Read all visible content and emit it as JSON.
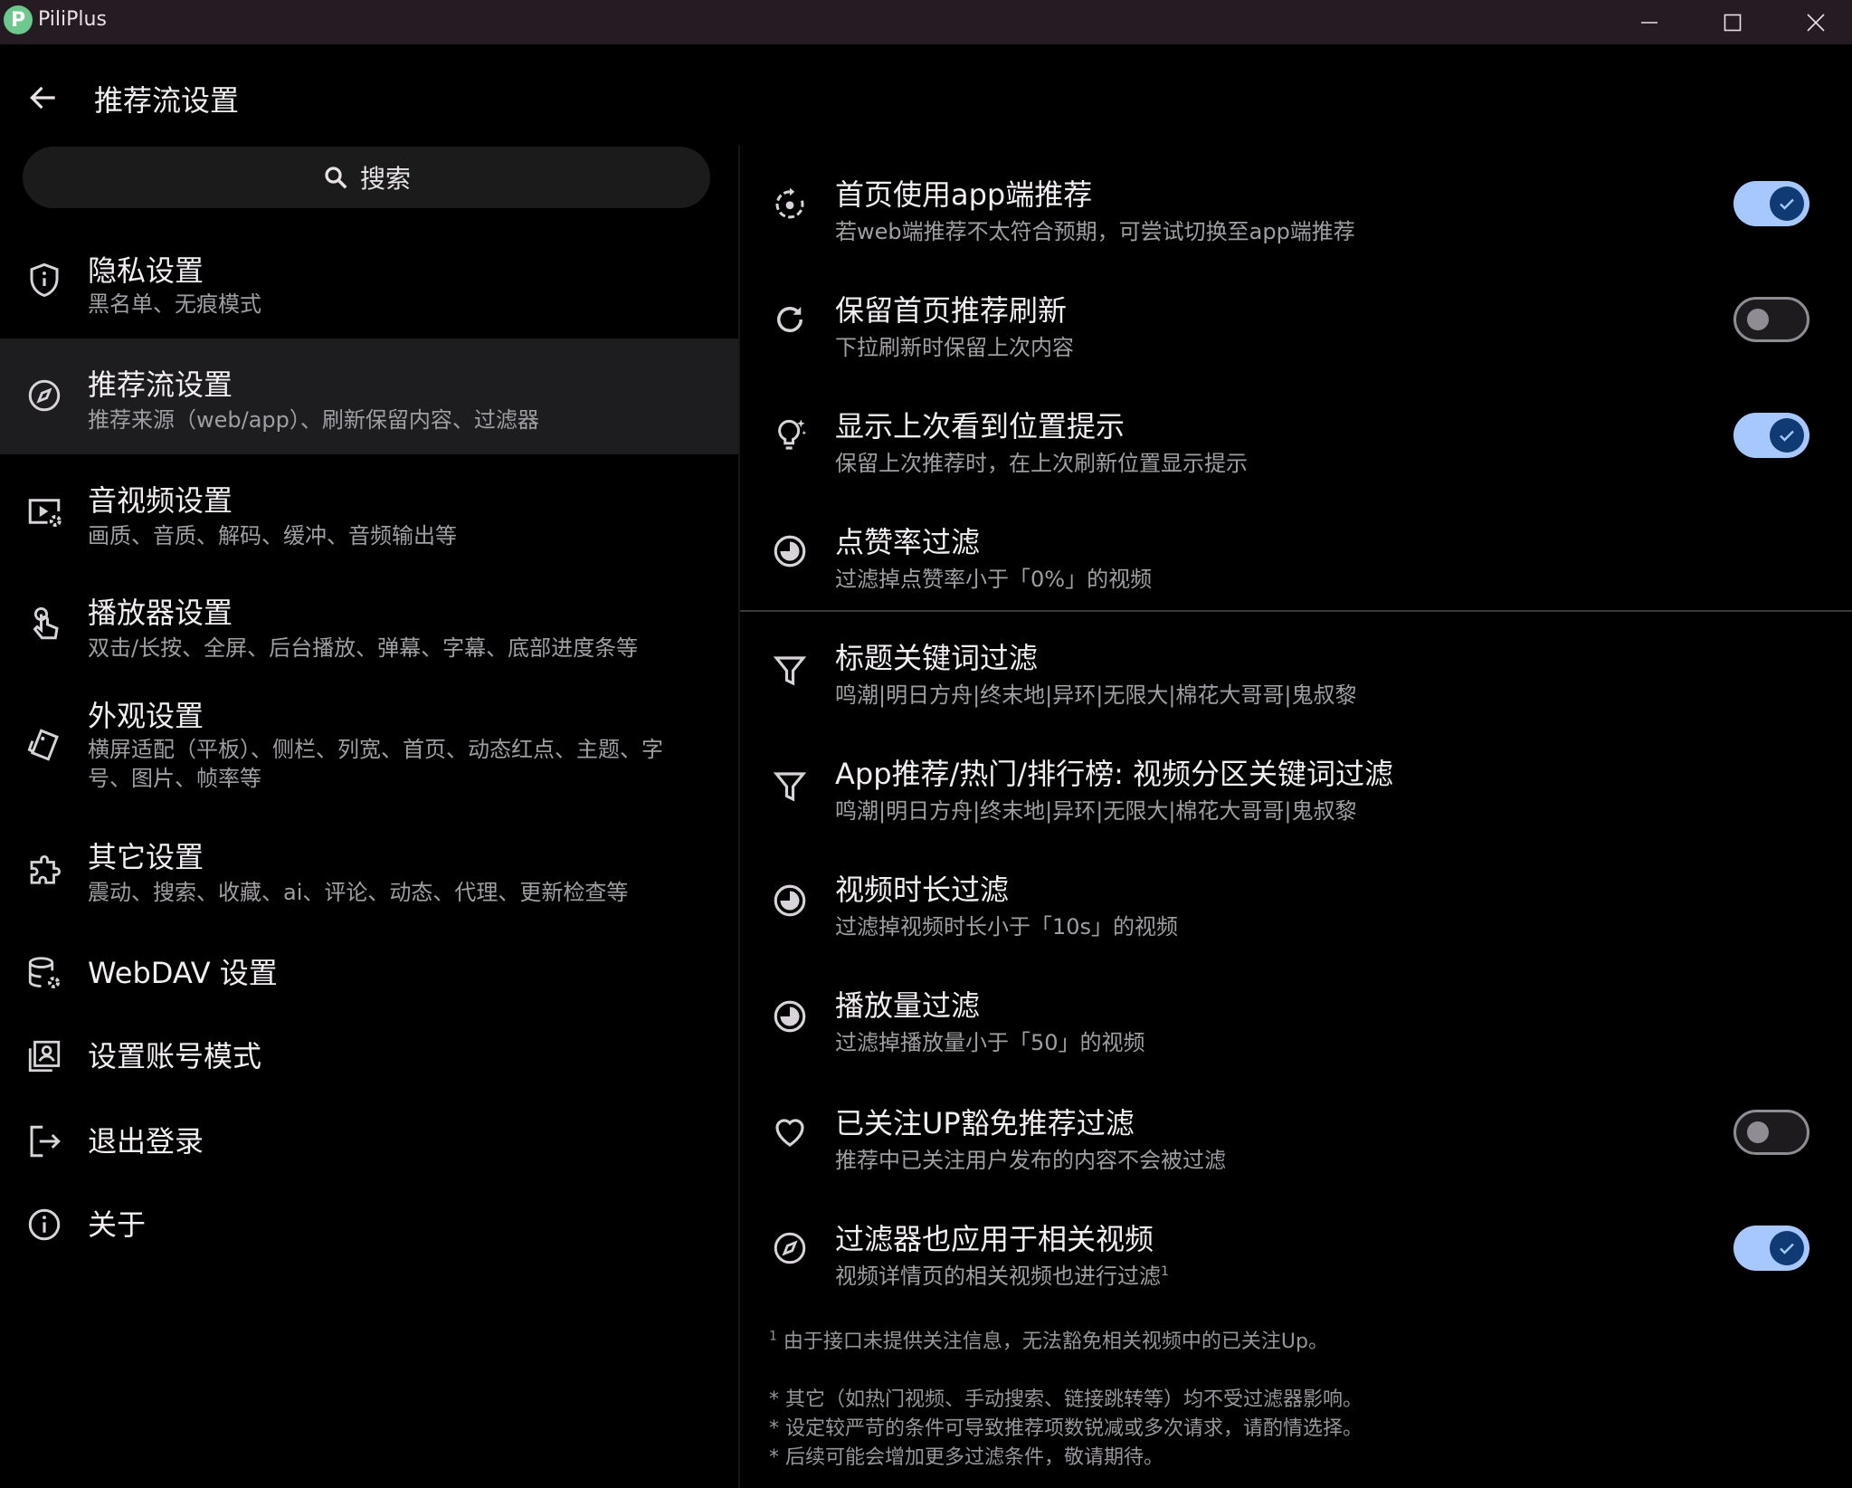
{
  "window": {
    "app_name": "PiliPlus",
    "logo_letter": "P"
  },
  "header": {
    "title": "推荐流设置"
  },
  "search": {
    "label": "搜索"
  },
  "nav": {
    "items": [
      {
        "id": "privacy",
        "title": "隐私设置",
        "subtitle": "黑名单、无痕模式",
        "icon": "shield-icon"
      },
      {
        "id": "recommend",
        "title": "推荐流设置",
        "subtitle": "推荐来源（web/app）、刷新保留内容、过滤器",
        "icon": "compass-icon",
        "active": true
      },
      {
        "id": "av",
        "title": "音视频设置",
        "subtitle": "画质、音质、解码、缓冲、音频输出等",
        "icon": "video-settings-icon"
      },
      {
        "id": "player",
        "title": "播放器设置",
        "subtitle": "双击/长按、全屏、后台播放、弹幕、字幕、底部进度条等",
        "icon": "touch-icon"
      },
      {
        "id": "appearance",
        "title": "外观设置",
        "subtitle": "横屏适配（平板）、侧栏、列宽、首页、动态红点、主题、字号、图片、帧率等",
        "icon": "style-icon"
      },
      {
        "id": "other",
        "title": "其它设置",
        "subtitle": "震动、搜索、收藏、ai、评论、动态、代理、更新检查等",
        "icon": "puzzle-icon"
      },
      {
        "id": "webdav",
        "title": "WebDAV 设置",
        "icon": "database-settings-icon"
      },
      {
        "id": "account",
        "title": "设置账号模式",
        "icon": "account-box-icon"
      },
      {
        "id": "logout",
        "title": "退出登录",
        "icon": "logout-icon"
      },
      {
        "id": "about",
        "title": "关于",
        "icon": "info-icon"
      }
    ]
  },
  "settings": {
    "items": [
      {
        "id": "app_recommend",
        "title": "首页使用app端推荐",
        "subtitle": "若web端推荐不太符合预期，可尝试切换至app端推荐",
        "icon": "rotate-icon",
        "toggle": true
      },
      {
        "id": "keep_refresh",
        "title": "保留首页推荐刷新",
        "subtitle": "下拉刷新时保留上次内容",
        "icon": "refresh-icon",
        "toggle": false
      },
      {
        "id": "last_position",
        "title": "显示上次看到位置提示",
        "subtitle": "保留上次推荐时，在上次刷新位置显示提示",
        "icon": "lightbulb-icon",
        "toggle": true
      },
      {
        "id": "like_rate",
        "title": "点赞率过滤",
        "subtitle": "过滤掉点赞率小于「0%」的视频",
        "icon": "contrast-icon"
      },
      {
        "id": "title_keyword",
        "title": "标题关键词过滤",
        "subtitle": "鸣潮|明日方舟|终末地|异环|无限大|棉花大哥哥|鬼叔黎",
        "icon": "filter-icon"
      },
      {
        "id": "zone_keyword",
        "title": "App推荐/热门/排行榜: 视频分区关键词过滤",
        "subtitle": "鸣潮|明日方舟|终末地|异环|无限大|棉花大哥哥|鬼叔黎",
        "icon": "filter-icon"
      },
      {
        "id": "duration",
        "title": "视频时长过滤",
        "subtitle": "过滤掉视频时长小于「10s」的视频",
        "icon": "contrast-icon"
      },
      {
        "id": "play_count",
        "title": "播放量过滤",
        "subtitle": "过滤掉播放量小于「50」的视频",
        "icon": "contrast-icon"
      },
      {
        "id": "follow_exempt",
        "title": "已关注UP豁免推荐过滤",
        "subtitle": "推荐中已关注用户发布的内容不会被过滤",
        "icon": "heart-icon",
        "toggle": false
      },
      {
        "id": "related_filter",
        "title": "过滤器也应用于相关视频",
        "subtitle": "视频详情页的相关视频也进行过滤",
        "sup": "1",
        "icon": "compass-icon",
        "toggle": true
      }
    ]
  },
  "notes": {
    "footnote_mark": "1",
    "footnote": " 由于接口未提供关注信息，无法豁免相关视频中的已关注Up。",
    "line1": "* 其它（如热门视频、手动搜索、链接跳转等）均不受过滤器影响。",
    "line2": "* 设定较严苛的条件可导致推荐项数锐减或多次请求，请酌情选择。",
    "line3": "* 后续可能会增加更多过滤条件，敬请期待。"
  },
  "colors": {
    "background": "#000000",
    "titlebar": "#251c23",
    "toggle_on_track": "#a6c8ff",
    "toggle_on_knob": "#0f3a73",
    "toggle_off_border": "#8f8c93",
    "active_nav": "#1d1d1f"
  }
}
